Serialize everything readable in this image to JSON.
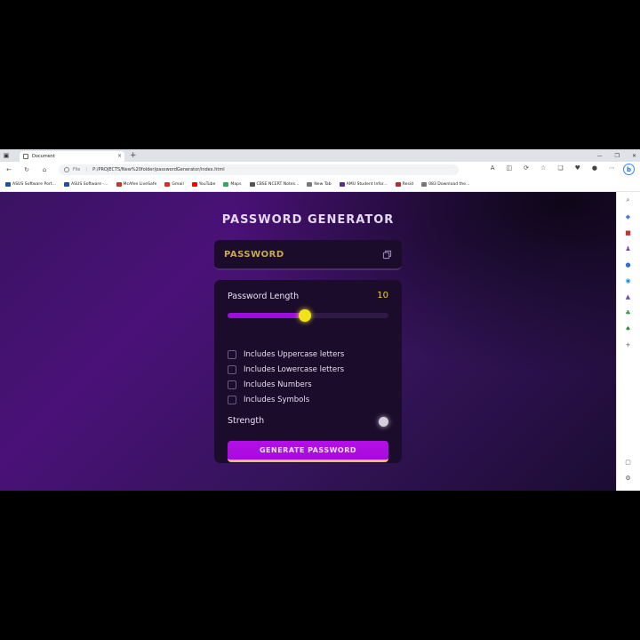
{
  "browser": {
    "tab_title": "Document",
    "new_tab_symbol": "+",
    "close_symbol": "×",
    "url_prefix": "File",
    "url": "P:/PROJECTS/New%20folder/passwordGenerator/index.html",
    "bookmarks": [
      {
        "label": "ASUS Software Port...",
        "color": "#1f4fa0"
      },
      {
        "label": "ASUS Software -...",
        "color": "#1f4fa0"
      },
      {
        "label": "McAfee LiveSafe",
        "color": "#c0392b"
      },
      {
        "label": "Gmail",
        "color": "#d93025"
      },
      {
        "label": "YouTube",
        "color": "#ff0000"
      },
      {
        "label": "Maps",
        "color": "#34a853"
      },
      {
        "label": "CBSE NCERT Notes...",
        "color": "#555555"
      },
      {
        "label": "New Tab",
        "color": "#777777"
      },
      {
        "label": "AMU Student Infor...",
        "color": "#5b2c8a"
      },
      {
        "label": "Resid",
        "color": "#b03030"
      },
      {
        "label": "083 Download the...",
        "color": "#777777"
      }
    ]
  },
  "app": {
    "title": "PASSWORD GENERATOR",
    "display_placeholder": "PASSWORD",
    "length_label": "Password Length",
    "length_value": "10",
    "length_fraction": 0.48,
    "options": [
      {
        "label": "Includes Uppercase letters",
        "checked": false
      },
      {
        "label": "Includes Lowercase letters",
        "checked": false
      },
      {
        "label": "Includes Numbers",
        "checked": false
      },
      {
        "label": "Includes Symbols",
        "checked": false
      }
    ],
    "strength_label": "Strength",
    "generate_label": "GENERATE PASSWORD"
  },
  "colors": {
    "accent": "#a00ce0",
    "thumb": "#f2e21b",
    "length_value": "#f2d31b",
    "display_text": "#c9a94e"
  }
}
